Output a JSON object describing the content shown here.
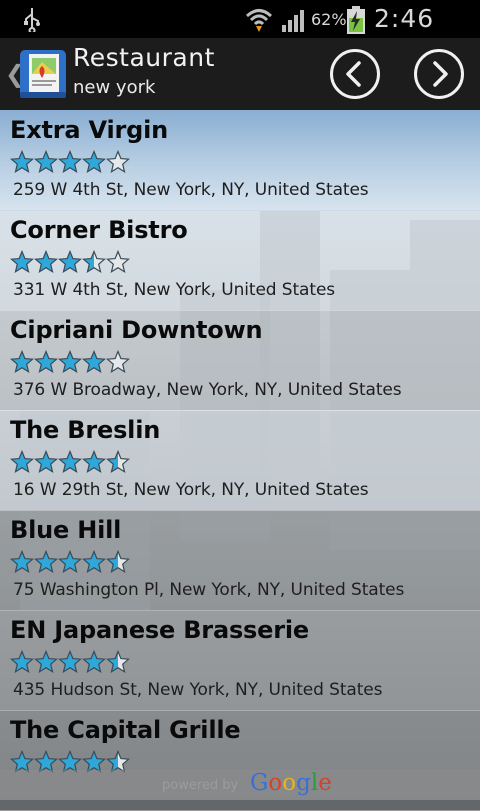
{
  "status_bar": {
    "usb_icon": "usb-icon",
    "wifi_icon": "wifi-icon",
    "signal_icon": "signal-icon",
    "battery_percent": "62%",
    "battery_icon": "battery-charging-icon",
    "time": "2:46 PM"
  },
  "action_bar": {
    "title": "Restaurant",
    "subtitle": "new york",
    "prev_icon": "chevron-left-circle-icon",
    "next_icon": "chevron-right-circle-icon"
  },
  "restaurants": [
    {
      "name": "Extra Virgin",
      "rating": 4,
      "address": "259 W 4th St, New York, NY, United States"
    },
    {
      "name": "Corner Bistro",
      "rating": 3.5,
      "address": "331 W 4th St, New York, United States"
    },
    {
      "name": "Cipriani Downtown",
      "rating": 4,
      "address": "376 W Broadway, New York, NY, United States"
    },
    {
      "name": "The Breslin",
      "rating": 4.5,
      "address": "16 W 29th St, New York, NY, United States"
    },
    {
      "name": "Blue Hill",
      "rating": 4.5,
      "address": "75 Washington Pl, New York, NY, United States"
    },
    {
      "name": "EN Japanese Brasserie",
      "rating": 4.5,
      "address": "435 Hudson St, New York, NY, United States"
    },
    {
      "name": "The Capital Grille",
      "rating": 4.5,
      "address": ""
    }
  ],
  "footer": {
    "powered_by": "powered by",
    "brand": "Google",
    "colors": {
      "blue": "#3b6fd8",
      "red": "#d8402c",
      "yellow": "#e9b51c",
      "green": "#2e9b3e"
    }
  },
  "colors": {
    "star_fill": "#2fa7d8",
    "selected_item": "#8aaed2"
  }
}
